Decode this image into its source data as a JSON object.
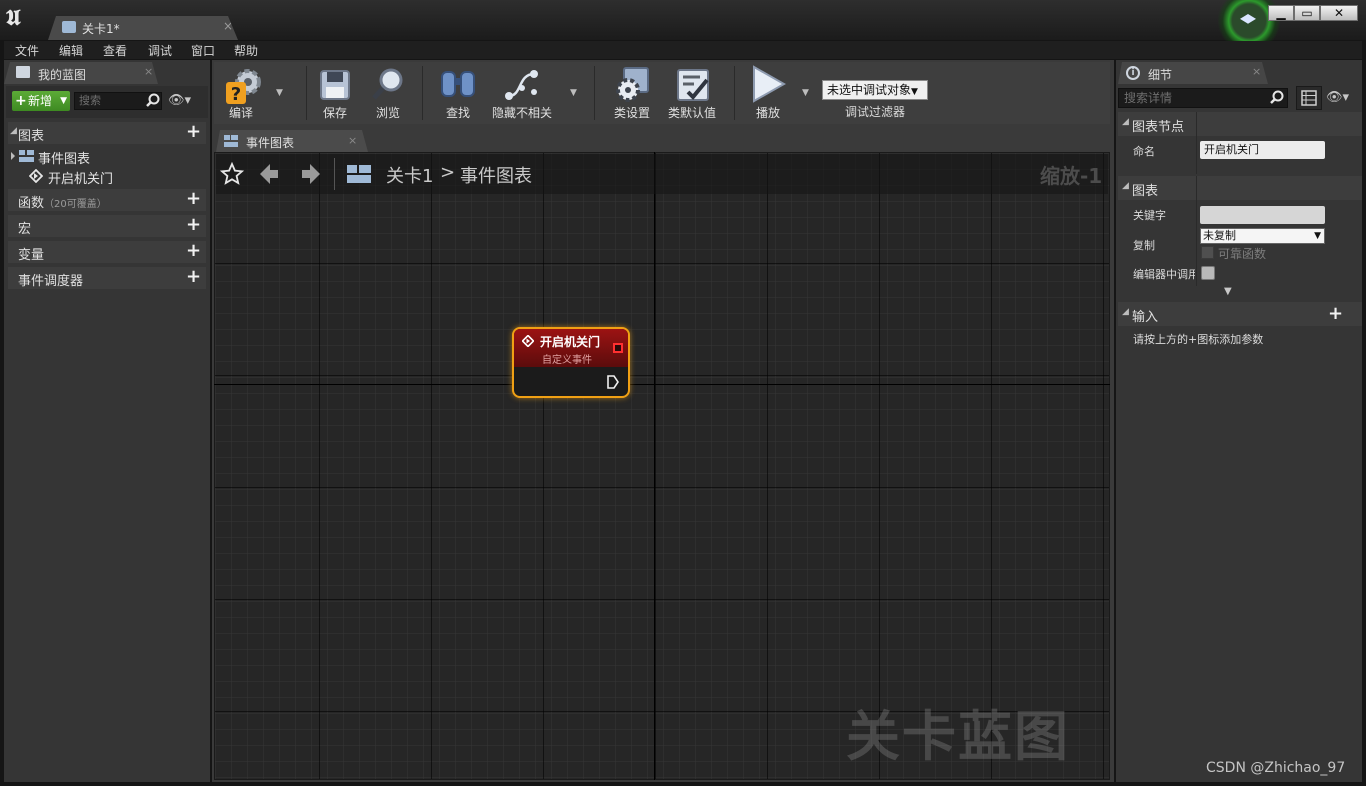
{
  "window": {
    "tab_title": "关卡1*",
    "tab_close": "×",
    "minimize": "▁",
    "maximize": "▭",
    "close": "✕"
  },
  "menu": [
    "文件",
    "编辑",
    "查看",
    "调试",
    "窗口",
    "帮助"
  ],
  "left_panel": {
    "tab_label": "我的蓝图",
    "tab_close": "×",
    "add_new_label": "新增",
    "search_placeholder": "搜索",
    "sections": {
      "graphs": "图表",
      "functions": "函数",
      "functions_hint": "（20可覆盖）",
      "macros": "宏",
      "variables": "变量",
      "dispatchers": "事件调度器"
    },
    "tree": {
      "event_graph": "事件图表",
      "custom_event": "开启机关门"
    }
  },
  "toolbar": {
    "compile": "编译",
    "save": "保存",
    "browse": "浏览",
    "find": "查找",
    "hide_unrelated": "隐藏不相关",
    "class_settings": "类设置",
    "class_defaults": "类默认值",
    "play": "播放",
    "debug_selection": "未选中调试对象",
    "debug_filter": "调试过滤器"
  },
  "graph": {
    "tab_label": "事件图表",
    "tab_close": "×",
    "breadcrumb_level": "关卡1",
    "breadcrumb_chevron": ">",
    "breadcrumb_graph": "事件图表",
    "zoom": "缩放-1",
    "watermark": "关卡蓝图",
    "node": {
      "title": "开启机关门",
      "subtitle": "自定义事件"
    }
  },
  "details": {
    "tab_label": "细节",
    "tab_close": "×",
    "search_placeholder": "搜索详情",
    "sections": {
      "graph_node": "图表节点",
      "graph": "图表",
      "inputs": "输入"
    },
    "labels": {
      "name": "命名",
      "keywords": "关键字",
      "replicates": "复制",
      "call_in_editor": "编辑器中调用"
    },
    "values": {
      "name": "开启机关门",
      "keywords": "",
      "replicates": "未复制",
      "reliable": "可靠函数"
    },
    "inputs_hint": "请按上方的+图标添加参数"
  },
  "footer": {
    "watermark": "CSDN @Zhichao_97"
  },
  "colors": {
    "node_border": "#f0a014",
    "node_header": "#9c1313",
    "add_button": "#4c9b2c"
  }
}
